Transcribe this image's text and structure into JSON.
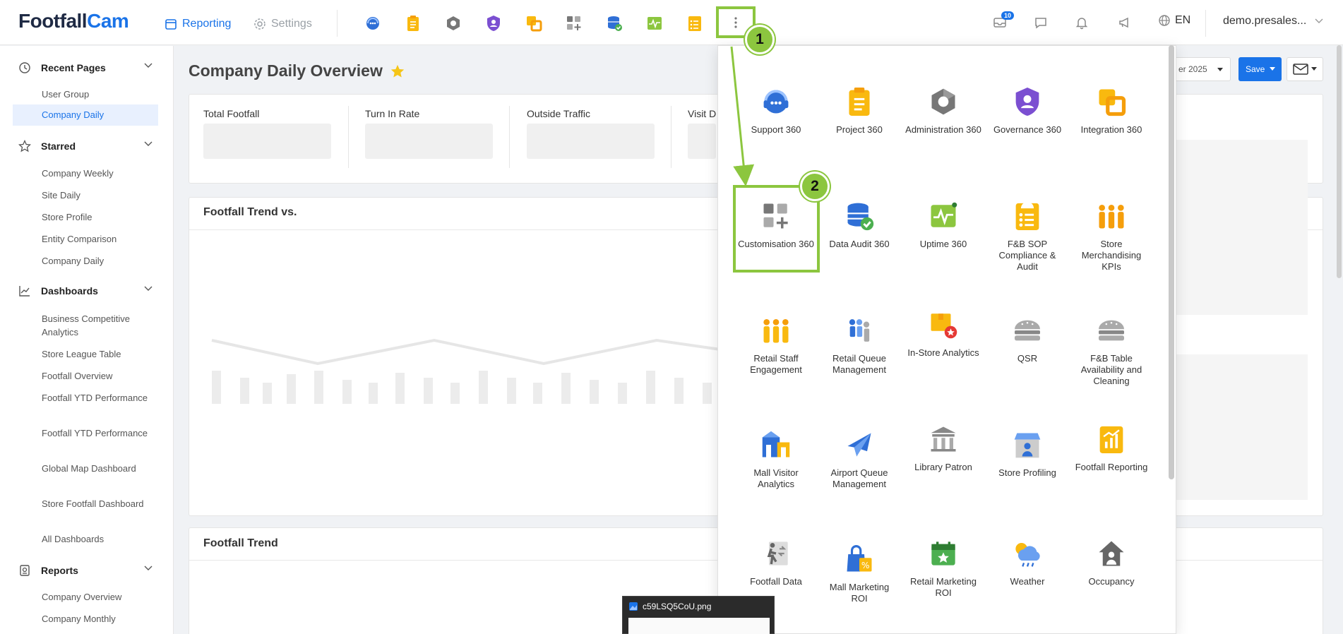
{
  "brand": {
    "name_part1": "Footfall",
    "name_part2": "Cam"
  },
  "nav": {
    "reporting": "Reporting",
    "settings": "Settings"
  },
  "topbar": {
    "notification_count": "10",
    "language": "EN",
    "user": "demo.presales..."
  },
  "sidebar": {
    "recent_pages": {
      "title": "Recent Pages",
      "items": [
        "User Group",
        "Company Daily"
      ]
    },
    "starred": {
      "title": "Starred",
      "items": [
        "Company Weekly",
        "Site Daily",
        "Store Profile",
        "Entity Comparison",
        "Company Daily"
      ]
    },
    "dashboards": {
      "title": "Dashboards",
      "items": [
        "Business Competitive Analytics",
        "Store League Table",
        "Footfall Overview",
        "Footfall YTD Performance",
        "Footfall YTD Performance",
        "Global Map Dashboard",
        "Store Footfall Dashboard",
        "All Dashboards"
      ]
    },
    "reports": {
      "title": "Reports",
      "items": [
        "Company Overview",
        "Company Monthly"
      ]
    }
  },
  "main": {
    "title": "Company Daily Overview",
    "kpis": [
      "Total Footfall",
      "Turn In Rate",
      "Outside Traffic",
      "Visit D"
    ],
    "card1_title": "Footfall Trend vs.",
    "card2_title": "Footfall Trend",
    "date_partial": "er 2025",
    "save_label": "Save"
  },
  "apps": [
    {
      "label": "Support 360",
      "icon": "headset-icon"
    },
    {
      "label": "Project 360",
      "icon": "clipboard-icon"
    },
    {
      "label": "Administration 360",
      "icon": "hexagon-icon"
    },
    {
      "label": "Governance 360",
      "icon": "shield-icon"
    },
    {
      "label": "Integration 360",
      "icon": "integration-icon"
    },
    {
      "label": "Customisation 360",
      "icon": "grid-plus-icon"
    },
    {
      "label": "Data Audit 360",
      "icon": "database-check-icon"
    },
    {
      "label": "Uptime 360",
      "icon": "pulse-icon"
    },
    {
      "label": "F&B SOP Compliance & Audit",
      "icon": "checklist-icon"
    },
    {
      "label": "Store Merchandising KPIs",
      "icon": "people-group-icon"
    },
    {
      "label": "Retail Staff Engagement",
      "icon": "staff-icon"
    },
    {
      "label": "Retail Queue Management",
      "icon": "queue-icon"
    },
    {
      "label": "In-Store Analytics",
      "icon": "box-star-icon"
    },
    {
      "label": "QSR",
      "icon": "burger-icon"
    },
    {
      "label": "F&B Table Availability and Cleaning",
      "icon": "table-icon"
    },
    {
      "label": "Mall Visitor Analytics",
      "icon": "mall-icon"
    },
    {
      "label": "Airport Queue Management",
      "icon": "airplane-icon"
    },
    {
      "label": "Library Patron",
      "icon": "library-icon"
    },
    {
      "label": "Store Profiling",
      "icon": "store-icon"
    },
    {
      "label": "Footfall Reporting",
      "icon": "report-chart-icon"
    },
    {
      "label": "Footfall Data",
      "icon": "walking-icon"
    },
    {
      "label": "Mall Marketing ROI",
      "icon": "shopping-bag-icon"
    },
    {
      "label": "Retail Marketing ROI",
      "icon": "calendar-star-icon"
    },
    {
      "label": "Weather",
      "icon": "weather-icon"
    },
    {
      "label": "Occupancy",
      "icon": "house-icon"
    }
  ],
  "steps": [
    "1",
    "2"
  ],
  "thumbnail": {
    "filename": "c59LSQ5CoU.png"
  },
  "colors": {
    "accent": "#1a73e8",
    "highlight": "#8cc63f",
    "app_yellow": "#f9b90f"
  }
}
